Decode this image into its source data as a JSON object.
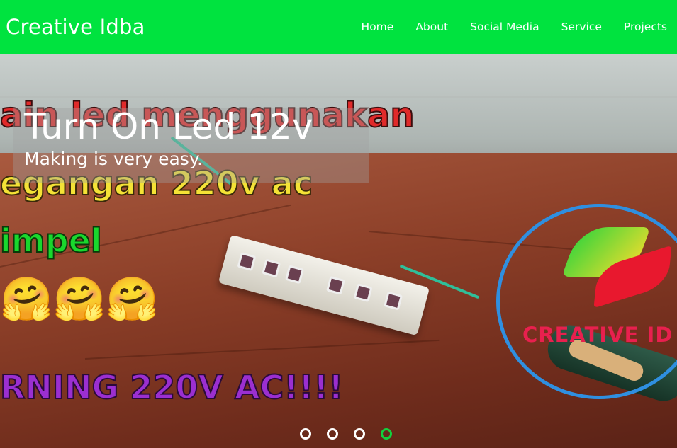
{
  "brand": "Creative Idba",
  "nav": {
    "items": [
      "Home",
      "About",
      "Social Media",
      "Service",
      "Projects"
    ]
  },
  "slide": {
    "title": "Turn On Led 12v",
    "subtitle": "Making is very easy.",
    "overlay_lines": [
      "ain led menggunakan",
      "egangan 220v ac",
      "impel",
      "RNING 220V AC!!!!"
    ],
    "emojis": "🤗🤗🤗",
    "logo_text": "CREATIVE ID"
  },
  "carousel": {
    "count": 4,
    "active_index": 3
  },
  "colors": {
    "navbar": "#00e33f",
    "active_dot": "#12d13e",
    "logo_ring": "#2f8fe0"
  }
}
